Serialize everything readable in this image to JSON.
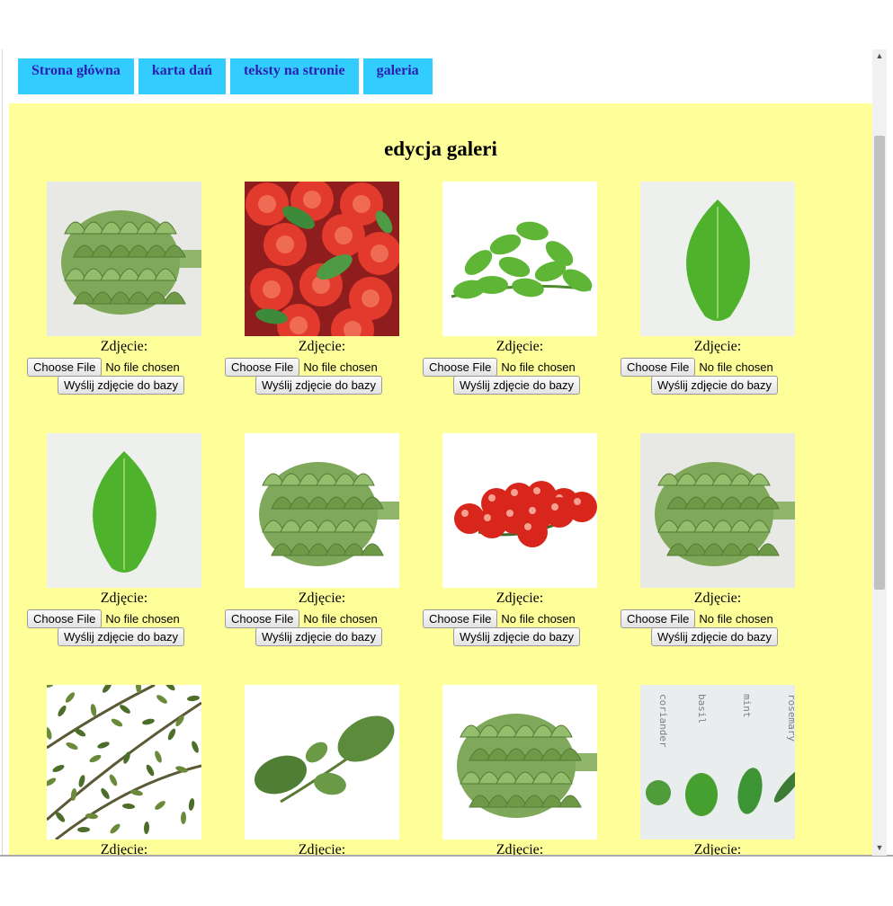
{
  "nav": {
    "items": [
      {
        "label": "Strona główna"
      },
      {
        "label": "karta dań"
      },
      {
        "label": "teksty na stronie"
      },
      {
        "label": "galeria"
      }
    ]
  },
  "page": {
    "title": "edycja galeri"
  },
  "gallery": {
    "caption": "Zdjęcie:",
    "choose_label": "Choose File",
    "no_file_label": "No file chosen",
    "upload_label": "Wyślij zdjęcie do bazy",
    "items": [
      {
        "image": "artichoke"
      },
      {
        "image": "tomato-salad"
      },
      {
        "image": "mint-sprig"
      },
      {
        "image": "basil-leaf"
      },
      {
        "image": "basil-leaf"
      },
      {
        "image": "artichoke-white"
      },
      {
        "image": "cherry-tomatoes"
      },
      {
        "image": "artichoke"
      },
      {
        "image": "thyme-sprigs"
      },
      {
        "image": "oregano-sprig"
      },
      {
        "image": "artichoke-white"
      },
      {
        "image": "herb-labels"
      }
    ],
    "herb_labels": [
      "coriander",
      "basil",
      "mint",
      "rosemary"
    ]
  },
  "colors": {
    "nav_bg": "#33ccff",
    "nav_text": "#2b1fb0",
    "content_bg": "#ffff99"
  }
}
